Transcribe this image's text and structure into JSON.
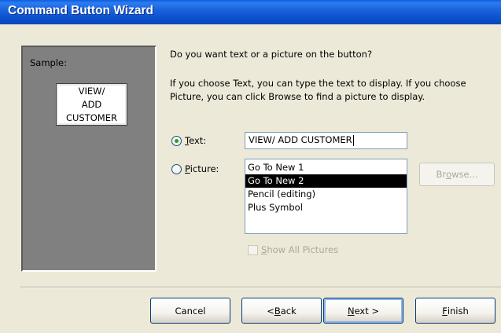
{
  "window": {
    "title": "Command Button Wizard"
  },
  "sample": {
    "label": "Sample:",
    "button_text": "VIEW/ ADD CUSTOMER"
  },
  "question": "Do you want text or a picture on the button?",
  "info": "If you choose Text, you can type the text to display.  If you choose Picture, you can click Browse to find a picture to display.",
  "options": {
    "text": {
      "accel": "T",
      "rest": "ext:",
      "checked": true,
      "value": "VIEW/ ADD CUSTOMER"
    },
    "picture": {
      "accel": "P",
      "rest": "icture:",
      "checked": false
    }
  },
  "picture_list": {
    "items": [
      "Go To New 1",
      "Go To New 2",
      "Pencil (editing)",
      "Plus Symbol"
    ],
    "selected": "Go To New 2"
  },
  "browse": {
    "pre": "Br",
    "accel": "o",
    "post": "wse...",
    "enabled": false
  },
  "show_all": {
    "pre": "",
    "accel": "S",
    "post": "how All Pictures",
    "checked": false,
    "enabled": false
  },
  "buttons": {
    "cancel": {
      "pre": "Cancel",
      "accel": "",
      "post": ""
    },
    "back": {
      "pre": "< ",
      "accel": "B",
      "post": "ack"
    },
    "next": {
      "pre": "",
      "accel": "N",
      "post": "ext >"
    },
    "finish": {
      "pre": "",
      "accel": "F",
      "post": "inish"
    }
  }
}
